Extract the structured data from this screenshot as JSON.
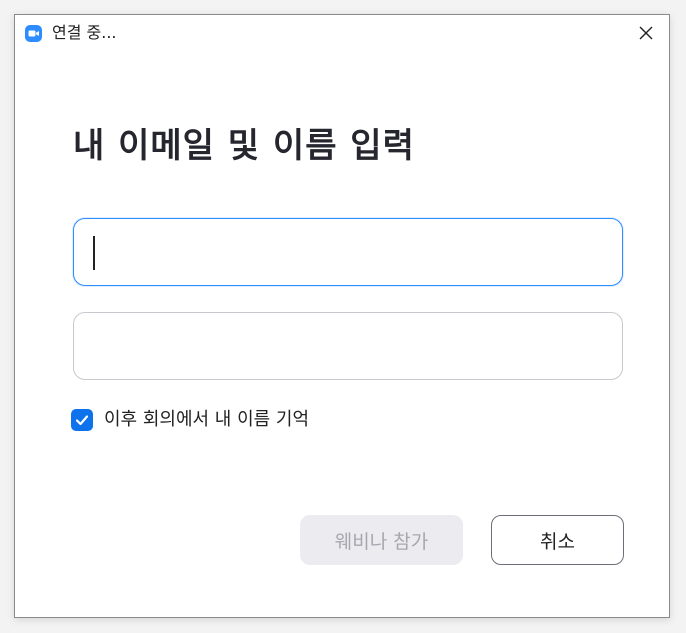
{
  "window": {
    "title": "연결 중...",
    "app_icon": "zoom-camera-icon",
    "close_icon": "close-icon"
  },
  "form": {
    "heading": "내 이메일 및 이름 입력",
    "name_input": {
      "value": "",
      "placeholder": ""
    },
    "email_input": {
      "value": "",
      "placeholder": ""
    },
    "remember": {
      "checked": true,
      "label": "이후 회의에서 내 이름 기억"
    }
  },
  "buttons": {
    "join_label": "웨비나 참가",
    "join_enabled": false,
    "cancel_label": "취소"
  },
  "colors": {
    "accent": "#2d8cff",
    "checkbox": "#0e72ed",
    "heading": "#26262e",
    "disabled_bg": "#ececf0",
    "disabled_text": "#a7a7b0"
  }
}
